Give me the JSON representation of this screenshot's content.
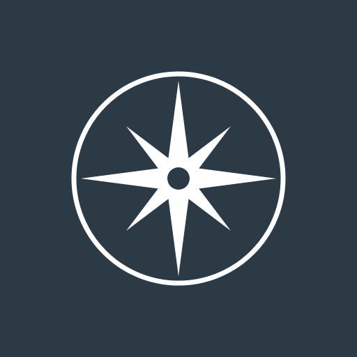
{
  "icon": {
    "name": "compass-rose-icon",
    "background_color": "#2c3a46",
    "foreground_color": "#ffffff"
  }
}
